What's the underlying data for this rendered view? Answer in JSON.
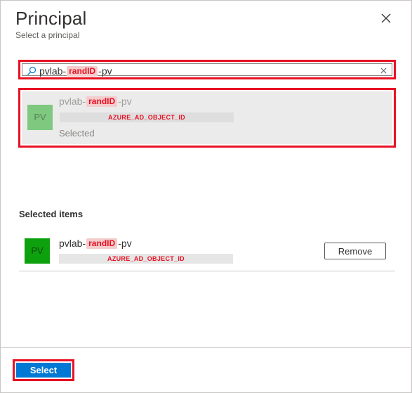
{
  "header": {
    "title": "Principal",
    "subtitle": "Select a principal"
  },
  "search": {
    "prefix": "pvlab-",
    "tag": "randID",
    "suffix": "-pv"
  },
  "result": {
    "avatar_initials": "PV",
    "name_prefix": "pvlab-",
    "name_tag": "randID",
    "name_suffix": "-pv",
    "object_id": "AZURE_AD_OBJECT_ID",
    "status": "Selected"
  },
  "selected_items": {
    "heading": "Selected items",
    "items": [
      {
        "avatar_initials": "PV",
        "name_prefix": "pvlab-",
        "name_tag": "randID",
        "name_suffix": "-pv",
        "object_id": "AZURE_AD_OBJECT_ID",
        "remove_label": "Remove"
      }
    ]
  },
  "footer": {
    "select_label": "Select"
  },
  "colors": {
    "accent": "#0078d4",
    "highlight_border": "#e81123",
    "avatar_solid": "#0ea10e",
    "avatar_faded": "#7fc87f"
  }
}
